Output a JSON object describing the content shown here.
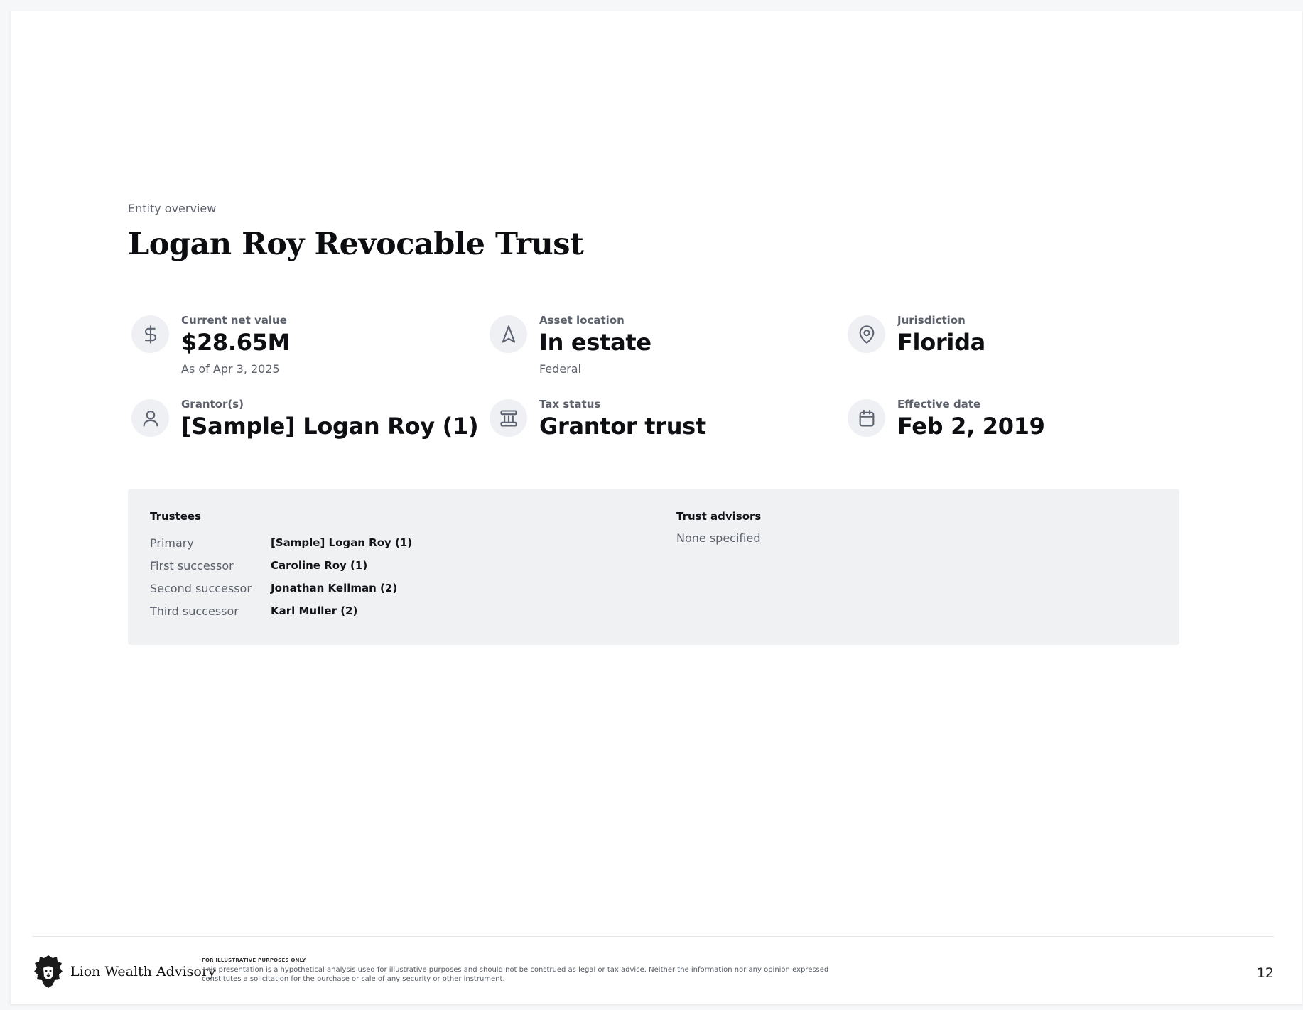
{
  "eyebrow": "Entity overview",
  "title": "Logan Roy Revocable Trust",
  "stats": [
    {
      "icon": "dollar-icon",
      "label": "Current net value",
      "value": "$28.65M",
      "sub": "As of Apr 3, 2025"
    },
    {
      "icon": "navigation-arrow-icon",
      "label": "Asset location",
      "value": "In estate",
      "sub": "Federal"
    },
    {
      "icon": "map-pin-icon",
      "label": "Jurisdiction",
      "value": "Florida",
      "sub": ""
    },
    {
      "icon": "user-icon",
      "label": "Grantor(s)",
      "value": "[Sample] Logan Roy (1)",
      "sub": ""
    },
    {
      "icon": "bank-icon",
      "label": "Tax status",
      "value": "Grantor trust",
      "sub": ""
    },
    {
      "icon": "calendar-icon",
      "label": "Effective date",
      "value": "Feb 2, 2019",
      "sub": ""
    }
  ],
  "trustees": {
    "heading": "Trustees",
    "rows": [
      {
        "role": "Primary",
        "name": "[Sample] Logan Roy (1)"
      },
      {
        "role": "First successor",
        "name": "Caroline Roy (1)"
      },
      {
        "role": "Second successor",
        "name": "Jonathan Kellman (2)"
      },
      {
        "role": "Third successor",
        "name": "Karl Muller (2)"
      }
    ]
  },
  "advisors": {
    "heading": "Trust advisors",
    "value": "None specified"
  },
  "footer": {
    "brand": "Lion Wealth Advisory",
    "disclaimer_heading": "FOR ILLUSTRATIVE PURPOSES ONLY",
    "disclaimer_body": "This presentation is a hypothetical analysis used for illustrative purposes and should not be construed as legal or tax advice. Neither the information nor any opinion expressed constitutes a solicitation for the purchase or sale of any security or other instrument.",
    "page_number": "12"
  },
  "colors": {
    "icon_bg": "#eef0f3",
    "panel_bg": "#f0f1f3",
    "muted_text": "#5b606b"
  }
}
